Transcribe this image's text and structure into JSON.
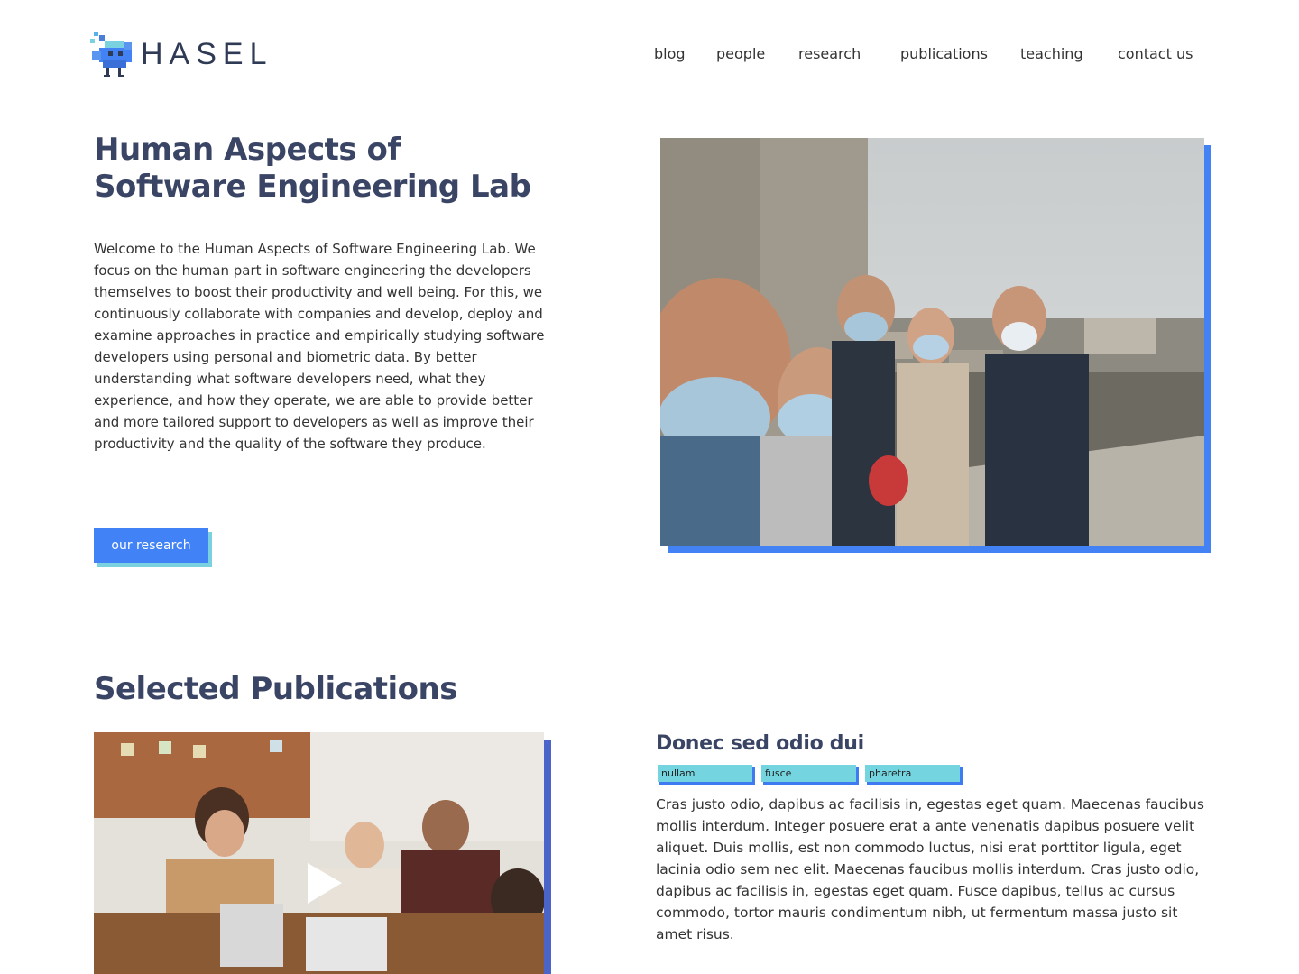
{
  "brand": {
    "name": "HASEL"
  },
  "nav": {
    "items": [
      {
        "label": "blog"
      },
      {
        "label": "people"
      },
      {
        "label": "research"
      },
      {
        "label": "publications"
      },
      {
        "label": "teaching"
      },
      {
        "label": "contact us"
      }
    ]
  },
  "hero": {
    "title": "Human Aspects of Software Engineering Lab",
    "paragraph": "Welcome to the Human Aspects of Software Engineering Lab. We focus on the human part in software engineering the developers themselves to boost their productivity and well being. For this, we continuously collaborate with companies and develop, deploy and examine approaches in practice and empirically studying software developers using personal and biometric data. By better understanding what software developers need, what they experience, and how they operate, we are able to provide better and more tailored support to developers as well as improve their productivity and the quality of the software they produce.",
    "button_label": "our research",
    "image_icon": "group-photo"
  },
  "publications": {
    "heading": "Selected Publications",
    "video_icon": "play-icon",
    "item": {
      "title": "Donec sed odio dui",
      "tags": [
        "nullam",
        "fusce",
        "pharetra"
      ],
      "body": "Cras justo odio, dapibus ac facilisis in, egestas eget quam. Maecenas faucibus mollis interdum. Integer posuere erat a ante venenatis dapibus posuere velit aliquet. Duis mollis, est non commodo luctus, nisi erat porttitor ligula, eget lacinia odio sem nec elit. Maecenas faucibus mollis interdum.  Cras justo odio, dapibus ac facilisis in, egestas eget quam. Fusce dapibus, tellus ac cursus commodo, tortor mauris condimentum nibh, ut fermentum massa justo sit amet risus."
    }
  },
  "colors": {
    "heading": "#3a4464",
    "accent_blue": "#4183f6",
    "accent_cyan": "#74d5e0",
    "video_shadow": "#4a64c9"
  }
}
